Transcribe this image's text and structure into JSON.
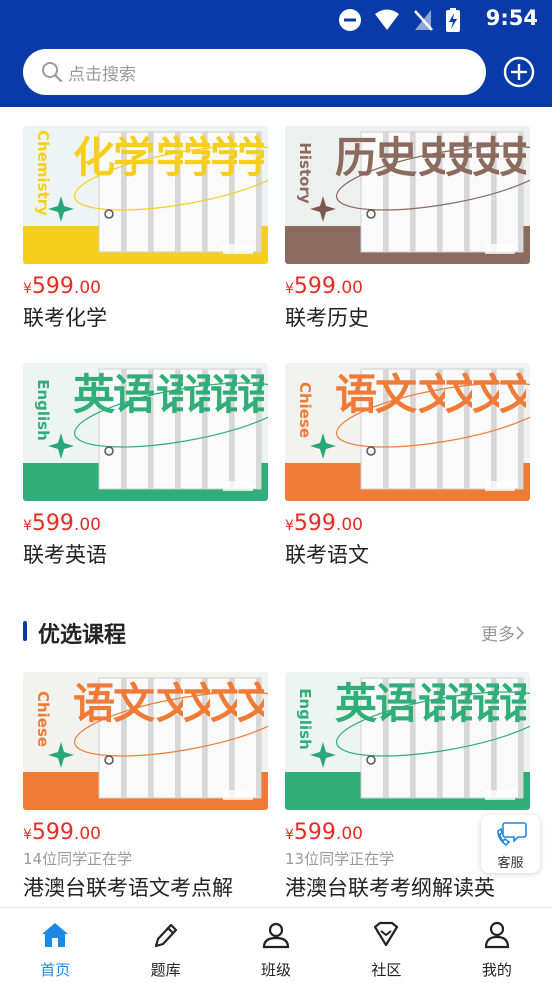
{
  "status": {
    "time": "9:54"
  },
  "search": {
    "placeholder": "点击搜索"
  },
  "grid": [
    {
      "price_int": "599",
      "price_dec": ".00",
      "title": "联考化学",
      "cover": {
        "big": "化学",
        "rep": "学",
        "vert": "Chemistry",
        "theme": "#f6cf1c",
        "bg": "#eef4f4",
        "accent": "#2aa77a"
      }
    },
    {
      "price_int": "599",
      "price_dec": ".00",
      "title": "联考历史",
      "cover": {
        "big": "历史",
        "rep": "史",
        "vert": "History",
        "theme": "#8a6b5e",
        "bg": "#eef0ef",
        "accent": "#7a5a50"
      }
    },
    {
      "price_int": "599",
      "price_dec": ".00",
      "title": "联考英语",
      "cover": {
        "big": "英语",
        "rep": "语",
        "vert": "English",
        "theme": "#2fae7a",
        "bg": "#eef4f2",
        "accent": "#2aa77a"
      }
    },
    {
      "price_int": "599",
      "price_dec": ".00",
      "title": "联考语文",
      "cover": {
        "big": "语文",
        "rep": "文",
        "vert": "Chiese",
        "theme": "#f07b37",
        "bg": "#f2f2ef",
        "accent": "#2aa77a"
      }
    }
  ],
  "section": {
    "title": "优选课程",
    "more": "更多"
  },
  "featured": [
    {
      "price_int": "599",
      "price_dec": ".00",
      "students": "14位同学正在学",
      "title": "港澳台联考语文考点解",
      "cover": {
        "big": "语文",
        "rep": "文",
        "vert": "Chiese",
        "theme": "#f07b37",
        "bg": "#f2f2ef",
        "accent": "#2aa77a"
      }
    },
    {
      "price_int": "599",
      "price_dec": ".00",
      "students": "13位同学正在学",
      "title": "港澳台联考考纲解读英",
      "cover": {
        "big": "英语",
        "rep": "语",
        "vert": "English",
        "theme": "#2fae7a",
        "bg": "#eef4f2",
        "accent": "#2aa77a"
      }
    }
  ],
  "support": {
    "label": "客服"
  },
  "tabs": [
    {
      "label": "首页",
      "icon": "home-icon",
      "active": true
    },
    {
      "label": "题库",
      "icon": "pencil-icon",
      "active": false
    },
    {
      "label": "班级",
      "icon": "class-icon",
      "active": false
    },
    {
      "label": "社区",
      "icon": "community-icon",
      "active": false
    },
    {
      "label": "我的",
      "icon": "profile-icon",
      "active": false
    }
  ],
  "colors": {
    "brand": "#0a3aa8",
    "price": "#e62d22",
    "active_tab": "#1e88e5"
  }
}
